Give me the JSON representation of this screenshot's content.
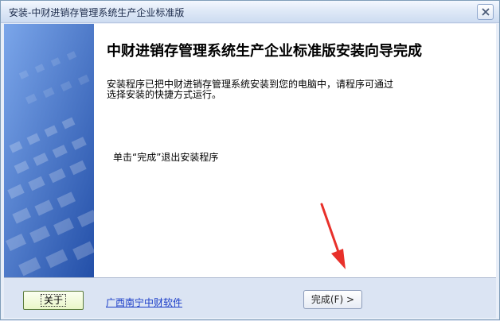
{
  "window": {
    "title": "安装-中财进销存管理系统生产企业标准版"
  },
  "content": {
    "heading": "中财进销存管理系统生产企业标准版安装向导完成",
    "description_line1": "安装程序已把中财进销存管理系统安装到您的电脑中，请程序可通过",
    "description_line2": "选择安装的快捷方式运行。",
    "hint": "单击“完成”退出安装程序"
  },
  "footer": {
    "about_label": "关于",
    "link_label": "广西南宁中财软件",
    "finish_label": "完成(F) >"
  },
  "colors": {
    "side_panel": "#3b6fd0",
    "annotation_arrow": "#e8302a",
    "link": "#1a3cc8"
  }
}
